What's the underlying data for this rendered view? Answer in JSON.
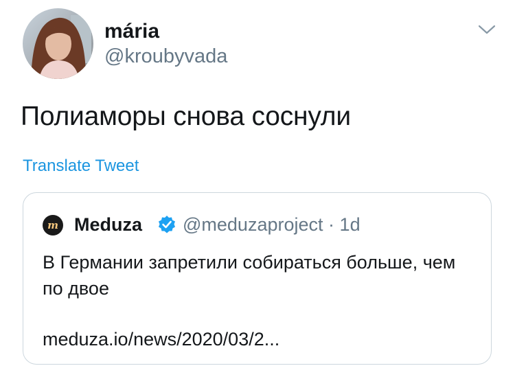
{
  "author": {
    "name": "mária",
    "handle": "@kroubyvada"
  },
  "tweet": {
    "text": "Полиаморы снова соснули",
    "translate_label": "Translate Tweet"
  },
  "quoted": {
    "name": "Meduza",
    "handle": "@meduzaproject",
    "separator": "·",
    "time": "1d",
    "text": "В Германии запретили собираться больше, чем по двое",
    "link": "meduza.io/news/2020/03/2..."
  },
  "colors": {
    "link_blue": "#1b95e0",
    "verified_blue": "#1da1f2",
    "muted_gray": "#657786",
    "border_gray": "#ccd6dd"
  },
  "icons": {
    "menu": "chevron-down-icon",
    "verified": "verified-badge-icon",
    "quoted_avatar": "meduza-logo-icon"
  }
}
